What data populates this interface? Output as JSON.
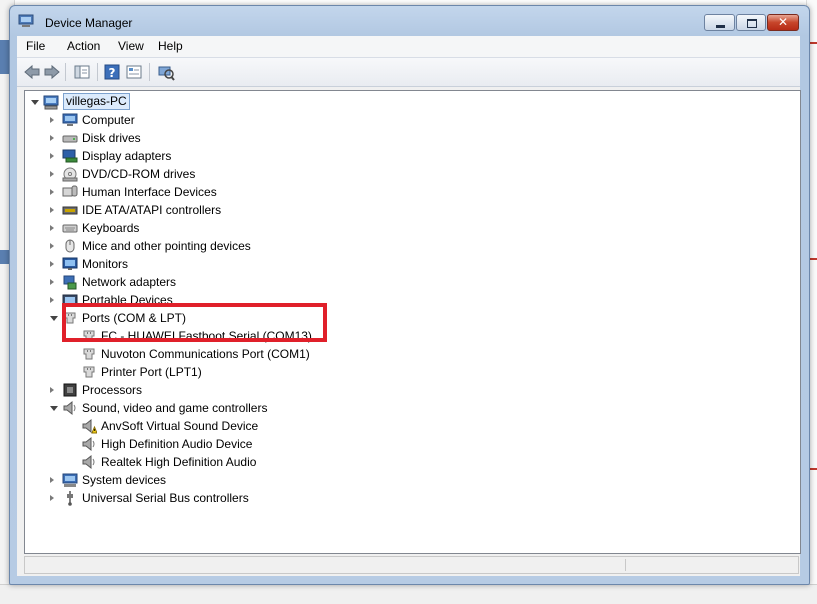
{
  "window": {
    "title": "Device Manager"
  },
  "menu": [
    "File",
    "Action",
    "View",
    "Help"
  ],
  "toolbar": {
    "buttons": [
      "back-icon",
      "forward-icon",
      "properties-panel-icon",
      "help-icon",
      "update-driver-icon",
      "scan-hardware-icon"
    ]
  },
  "tree": {
    "root": "villegas-PC",
    "categories": [
      {
        "label": "Computer",
        "icon": "computer-icon",
        "expanded": false
      },
      {
        "label": "Disk drives",
        "icon": "disk-drive-icon",
        "expanded": false
      },
      {
        "label": "Display adapters",
        "icon": "display-adapter-icon",
        "expanded": false
      },
      {
        "label": "DVD/CD-ROM drives",
        "icon": "dvd-drive-icon",
        "expanded": false
      },
      {
        "label": "Human Interface Devices",
        "icon": "hid-icon",
        "expanded": false
      },
      {
        "label": "IDE ATA/ATAPI controllers",
        "icon": "ide-controller-icon",
        "expanded": false
      },
      {
        "label": "Keyboards",
        "icon": "keyboard-icon",
        "expanded": false
      },
      {
        "label": "Mice and other pointing devices",
        "icon": "mouse-icon",
        "expanded": false
      },
      {
        "label": "Monitors",
        "icon": "monitor-icon",
        "expanded": false
      },
      {
        "label": "Network adapters",
        "icon": "network-adapter-icon",
        "expanded": false
      },
      {
        "label": "Portable Devices",
        "icon": "portable-device-icon",
        "expanded": false
      },
      {
        "label": "Ports (COM & LPT)",
        "icon": "port-icon",
        "expanded": true,
        "children": [
          {
            "label": "FC - HUAWEI Fastboot Serial (COM13)",
            "icon": "port-icon"
          },
          {
            "label": "Nuvoton Communications Port (COM1)",
            "icon": "port-icon"
          },
          {
            "label": "Printer Port (LPT1)",
            "icon": "port-icon"
          }
        ]
      },
      {
        "label": "Processors",
        "icon": "processor-icon",
        "expanded": false
      },
      {
        "label": "Sound, video and game controllers",
        "icon": "speaker-icon",
        "expanded": true,
        "children": [
          {
            "label": "AnvSoft Virtual Sound Device",
            "icon": "speaker-warning-icon"
          },
          {
            "label": "High Definition Audio Device",
            "icon": "speaker-icon"
          },
          {
            "label": "Realtek High Definition Audio",
            "icon": "speaker-icon"
          }
        ]
      },
      {
        "label": "System devices",
        "icon": "system-device-icon",
        "expanded": false
      },
      {
        "label": "Universal Serial Bus controllers",
        "icon": "usb-icon",
        "expanded": false
      }
    ]
  },
  "colors": {
    "highlight_box": "#e0202a",
    "selection": "#dcebfc"
  }
}
